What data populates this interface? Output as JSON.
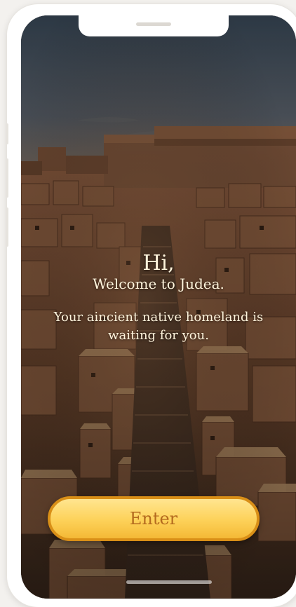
{
  "welcome": {
    "greeting": "Hi,",
    "subtitle": "Welcome to Judea.",
    "message": "Your aincient native homeland is waiting for you."
  },
  "actions": {
    "enter_label": "Enter"
  },
  "colors": {
    "text": "#fff4dc",
    "button_fill": "#fdd158",
    "button_border": "#d98f17",
    "button_text": "#b46a1e"
  }
}
